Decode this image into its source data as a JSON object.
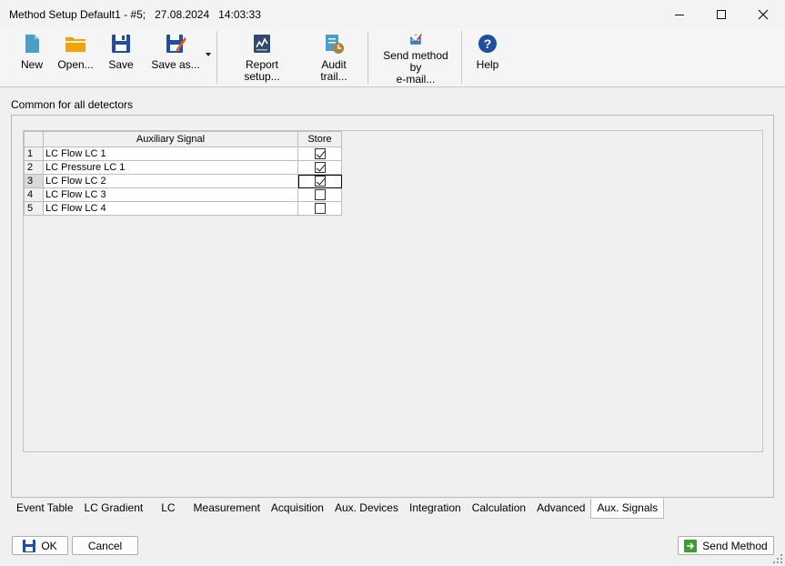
{
  "window": {
    "title": "Method Setup Default1 - #5;   27.08.2024   14:03:33",
    "colors": {
      "accent_blue": "#1f4fa3",
      "folder_orange": "#f2a20a",
      "doc_teal": "#4a9fc4",
      "send_green": "#3d9b35"
    }
  },
  "toolbar": {
    "buttons": [
      {
        "label": "New",
        "icon": "new-document-icon"
      },
      {
        "label": "Open...",
        "icon": "folder-open-icon"
      },
      {
        "label": "Save",
        "icon": "floppy-disk-icon"
      },
      {
        "label": "Save as...",
        "icon": "save-as-icon"
      },
      {
        "label": "Report setup...",
        "icon": "report-setup-icon"
      },
      {
        "label": "Audit trail...",
        "icon": "audit-trail-icon"
      },
      {
        "label": "Send method by\ne-mail...",
        "icon": "email-method-icon"
      },
      {
        "label": "Help",
        "icon": "help-icon"
      }
    ]
  },
  "section": {
    "label": "Common for all detectors"
  },
  "grid": {
    "headers": {
      "row": "",
      "signal": "Auxiliary Signal",
      "store": "Store"
    },
    "rows": [
      {
        "num": "1",
        "signal": "LC Flow LC 1",
        "store": true
      },
      {
        "num": "2",
        "signal": "LC Pressure LC 1",
        "store": true
      },
      {
        "num": "3",
        "signal": "LC Flow LC 2",
        "store": true
      },
      {
        "num": "4",
        "signal": "LC Flow LC 3",
        "store": false
      },
      {
        "num": "5",
        "signal": "LC Flow LC 4",
        "store": false
      }
    ]
  },
  "tabs": [
    {
      "label": "Event Table",
      "active": false
    },
    {
      "label": "LC Gradient",
      "active": false
    },
    {
      "label": "LC",
      "active": false
    },
    {
      "label": "Measurement",
      "active": false
    },
    {
      "label": "Acquisition",
      "active": false
    },
    {
      "label": "Aux. Devices",
      "active": false
    },
    {
      "label": "Integration",
      "active": false
    },
    {
      "label": "Calculation",
      "active": false
    },
    {
      "label": "Advanced",
      "active": false
    },
    {
      "label": "Aux. Signals",
      "active": true
    }
  ],
  "footer": {
    "ok_label": "OK",
    "cancel_label": "Cancel",
    "send_label": "Send Method"
  }
}
